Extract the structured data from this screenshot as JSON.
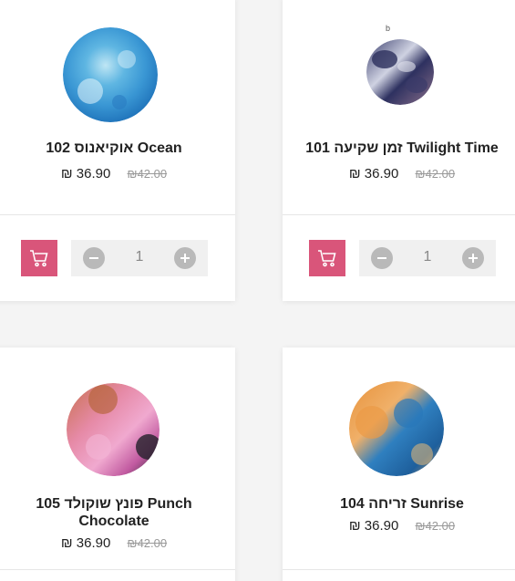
{
  "currency": "₪",
  "colors": {
    "accent": "#d9557a",
    "stepper_bg": "#f0f0f0",
    "stepper_btn": "#b9b9b9"
  },
  "products": [
    {
      "title": "102 אוקיאנוס Ocean",
      "price_now": "36.90",
      "price_old": "42.00",
      "quantity": "1",
      "swatch": "ocean"
    },
    {
      "title": "101 זמן שקיעה Twilight Time",
      "price_now": "36.90",
      "price_old": "42.00",
      "quantity": "1",
      "swatch": "twilight",
      "mark": "b"
    },
    {
      "title_line1": "105 פונץ שוקולד Punch",
      "title_line2": "Chocolate",
      "price_now": "36.90",
      "price_old": "42.00",
      "swatch": "punch-chocolate"
    },
    {
      "title": "104 זריחה Sunrise",
      "price_now": "36.90",
      "price_old": "42.00",
      "swatch": "sunrise"
    }
  ],
  "icons": {
    "cart": "shopping-cart-icon",
    "minus": "minus-icon",
    "plus": "plus-icon"
  }
}
